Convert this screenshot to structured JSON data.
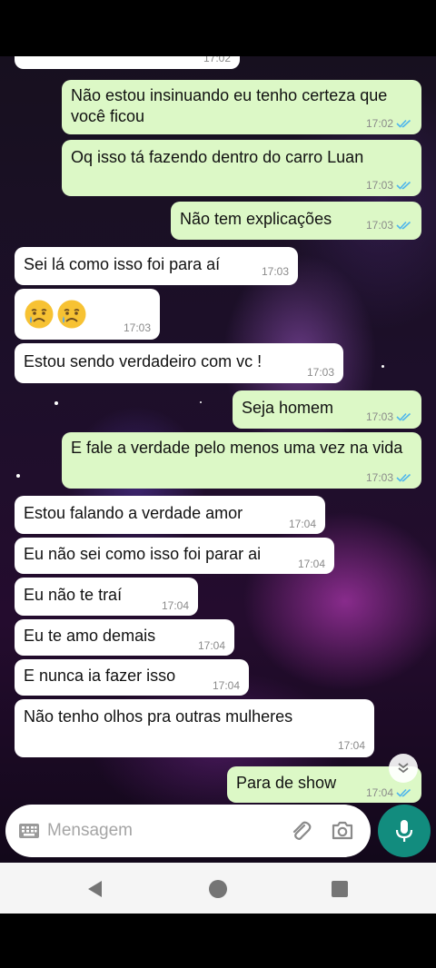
{
  "top_bubble_time": "17:02",
  "messages": [
    {
      "dir": "out",
      "text": "Não estou insinuando eu tenho certeza que você ficou",
      "time": "17:02",
      "read": true
    },
    {
      "dir": "out",
      "text": "Oq isso tá fazendo dentro do carro Luan",
      "time": "17:03",
      "read": true
    },
    {
      "dir": "out",
      "text": "Não tem explicações",
      "time": "17:03",
      "read": true
    },
    {
      "dir": "in",
      "text": "Sei lá como isso foi para aí",
      "time": "17:03"
    },
    {
      "dir": "in",
      "emoji": [
        "sad-relieved-face",
        "sad-relieved-face"
      ],
      "time": "17:03"
    },
    {
      "dir": "in",
      "text": "Estou sendo verdadeiro com vc !",
      "time": "17:03"
    },
    {
      "dir": "out",
      "text": "Seja homem",
      "time": "17:03",
      "read": true
    },
    {
      "dir": "out",
      "text": "E fale a verdade pelo menos uma vez na vida",
      "time": "17:03",
      "read": true
    },
    {
      "dir": "in",
      "text": "Estou falando a verdade amor",
      "time": "17:04"
    },
    {
      "dir": "in",
      "text": "Eu não sei como isso foi parar ai",
      "time": "17:04"
    },
    {
      "dir": "in",
      "text": "Eu não te traí",
      "time": "17:04"
    },
    {
      "dir": "in",
      "text": "Eu te amo demais",
      "time": "17:04"
    },
    {
      "dir": "in",
      "text": "E nunca ia fazer isso",
      "time": "17:04"
    },
    {
      "dir": "in",
      "text": "Não tenho olhos pra outras mulheres",
      "time": "17:04"
    },
    {
      "dir": "out",
      "text": "Para de show",
      "time": "17:04",
      "read": true
    }
  ],
  "composer": {
    "placeholder": "Mensagem",
    "icons": [
      "keyboard-icon",
      "attach-icon",
      "camera-icon",
      "mic-icon"
    ]
  },
  "colors": {
    "outgoing_bubble": "#dcf8c6",
    "incoming_bubble": "#ffffff",
    "read_ticks": "#4fb6ec",
    "mic_button": "#128c7e"
  },
  "navbar": {
    "icons": [
      "back-icon",
      "home-icon",
      "recents-icon"
    ]
  }
}
